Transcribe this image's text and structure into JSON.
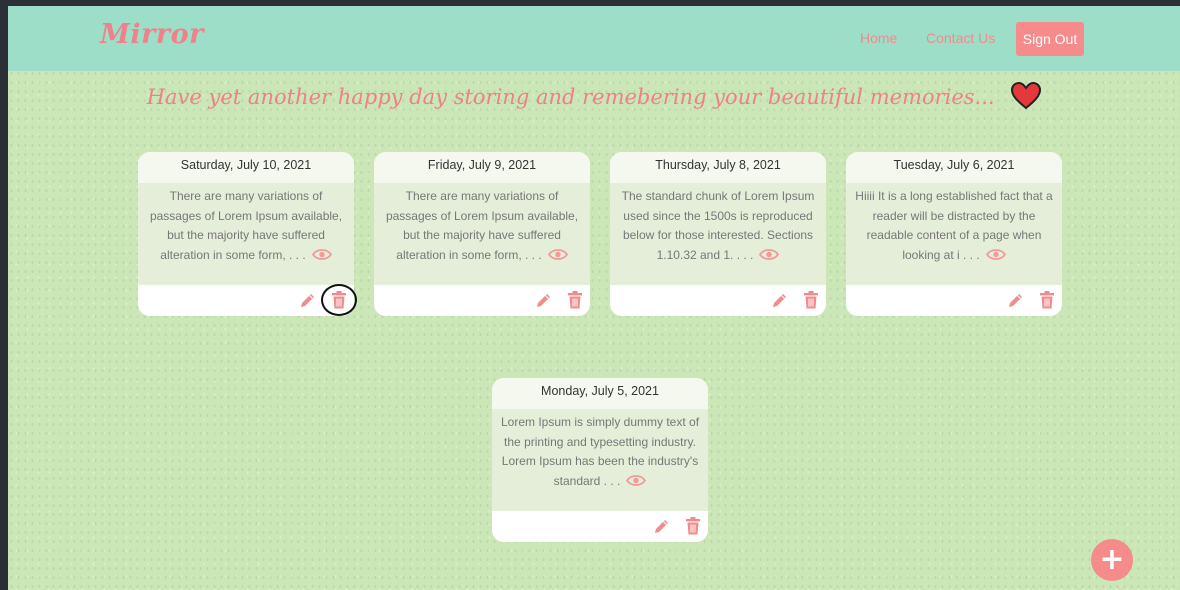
{
  "brand": {
    "name": "Mirror"
  },
  "nav": {
    "home": "Home",
    "contact": "Contact Us",
    "signout": "Sign Out"
  },
  "tagline": "Have yet another happy day storing and remebering your beautiful memories...",
  "cards": [
    {
      "date": "Saturday, July 10, 2021",
      "text": "There are many variations of passages of Lorem Ipsum available, but the majority have suffered alteration in some form, . . ."
    },
    {
      "date": "Friday, July 9, 2021",
      "text": "There are many variations of passages of Lorem Ipsum available, but the majority have suffered alteration in some form, . . ."
    },
    {
      "date": "Thursday, July 8, 2021",
      "text": "The standard chunk of Lorem Ipsum used since the 1500s is reproduced below for those interested. Sections 1.10.32 and 1. . . ."
    },
    {
      "date": "Tuesday, July 6, 2021",
      "text": "Hiiii It is a long established fact that a reader will be distracted by the readable content of a page when looking at i . . ."
    },
    {
      "date": "Monday, July 5, 2021",
      "text": "Lorem Ipsum is simply dummy text of the printing and typesetting industry. Lorem Ipsum has been the industry's standard . . ."
    }
  ],
  "fab": {
    "symbol": "+"
  },
  "colors": {
    "navbar": "#9ddec8",
    "accent": "#f58b8b",
    "background": "#cbe7b8"
  }
}
